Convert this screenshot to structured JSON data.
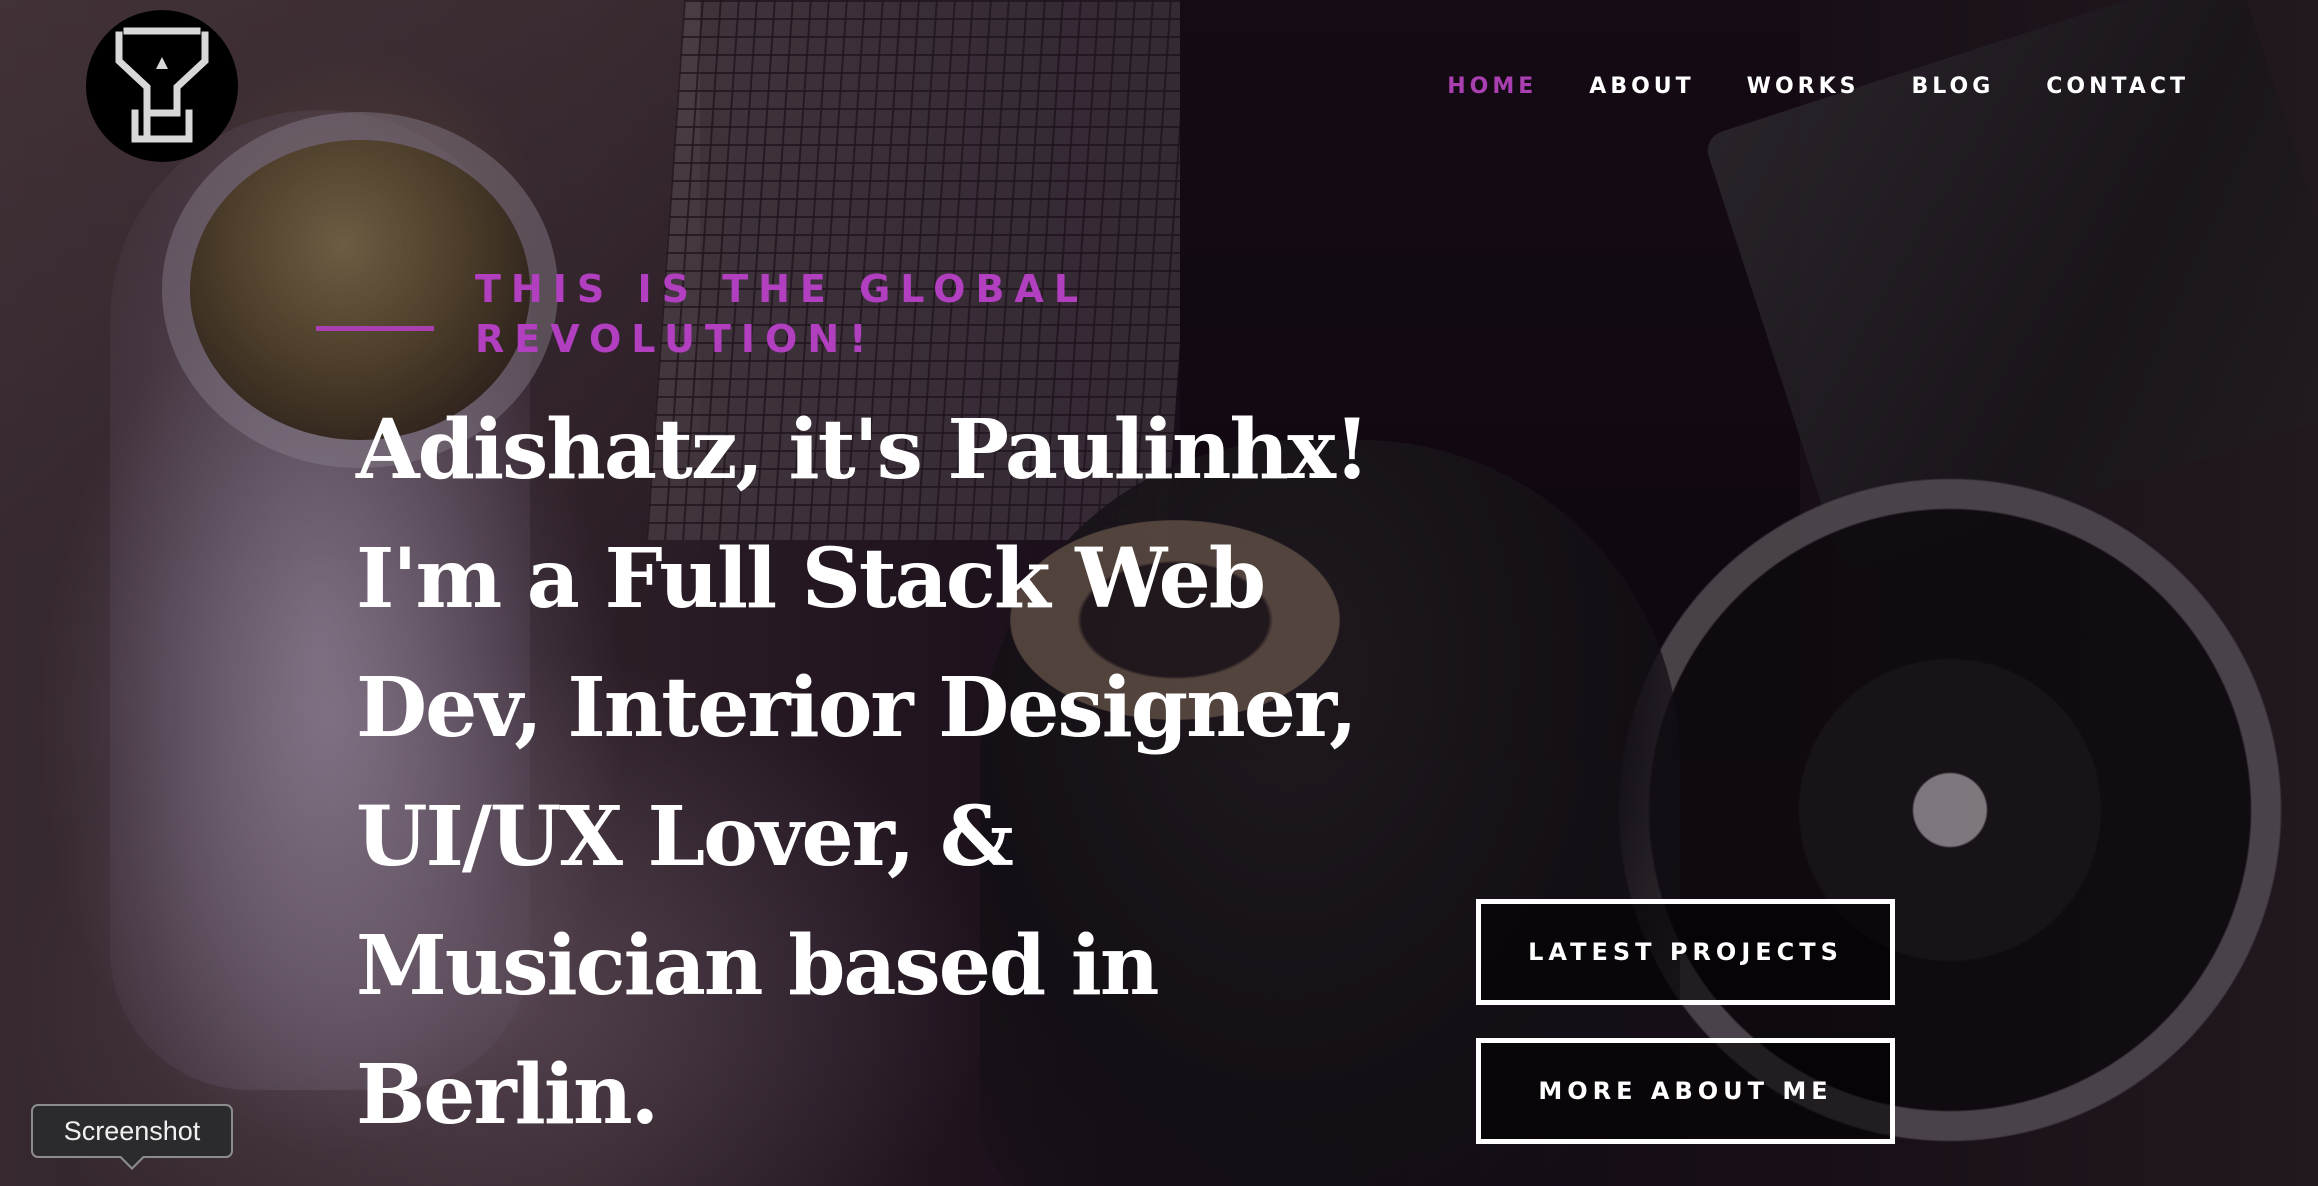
{
  "logo": {
    "icon": "monogram-logo-icon"
  },
  "nav": {
    "items": [
      {
        "label": "HOME",
        "active": true
      },
      {
        "label": "ABOUT",
        "active": false
      },
      {
        "label": "WORKS",
        "active": false
      },
      {
        "label": "BLOG",
        "active": false
      },
      {
        "label": "CONTACT",
        "active": false
      }
    ]
  },
  "hero": {
    "tagline_lines": [
      "THIS IS THE GLOBAL",
      "REVOLUTION!"
    ],
    "headline_lines": [
      "Adishatz, it's Paulinhx!",
      "I'm a Full Stack Web",
      "Dev, Interior Designer,",
      "UI/UX Lover, &",
      "Musician based in",
      "Berlin."
    ]
  },
  "buttons": {
    "latest_projects": "LATEST PROJECTS",
    "more_about_me": "MORE ABOUT ME"
  },
  "tooltip": {
    "label": "Screenshot"
  },
  "colors": {
    "accent": "#a93fb0",
    "text": "#ffffff",
    "button_border": "#ffffff"
  }
}
